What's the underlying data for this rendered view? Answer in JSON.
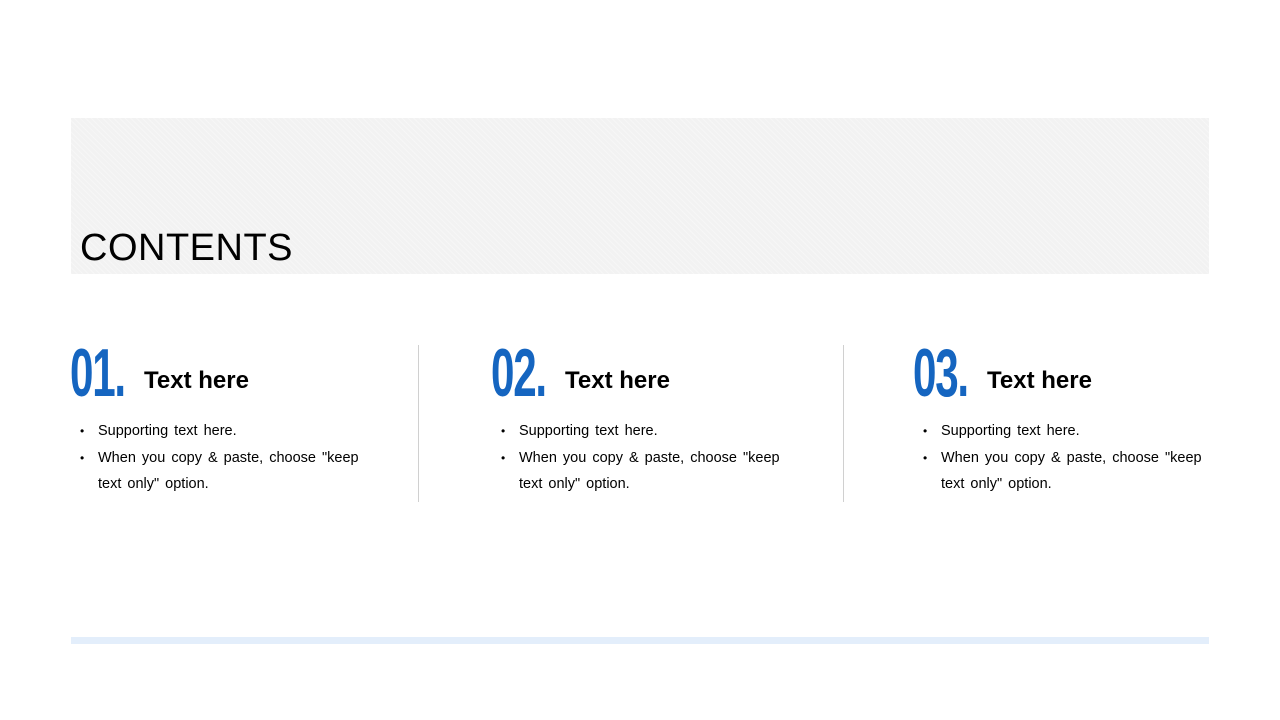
{
  "title": "CONTENTS",
  "sections": [
    {
      "number": "01.",
      "heading": "Text here",
      "bullets": [
        "Supporting text here.",
        "When you copy & paste, choose \"keep text only\" option."
      ]
    },
    {
      "number": "02.",
      "heading": "Text here",
      "bullets": [
        "Supporting text here.",
        "When you copy & paste, choose \"keep text only\" option."
      ]
    },
    {
      "number": "03.",
      "heading": "Text here",
      "bullets": [
        "Supporting text here.",
        "When you copy & paste, choose \"keep text only\" option."
      ]
    }
  ],
  "colors": {
    "accent": "#1565c0",
    "header_band": "#f2f2f2",
    "footer_line": "#e3eefb",
    "divider": "#d0d0d0"
  }
}
